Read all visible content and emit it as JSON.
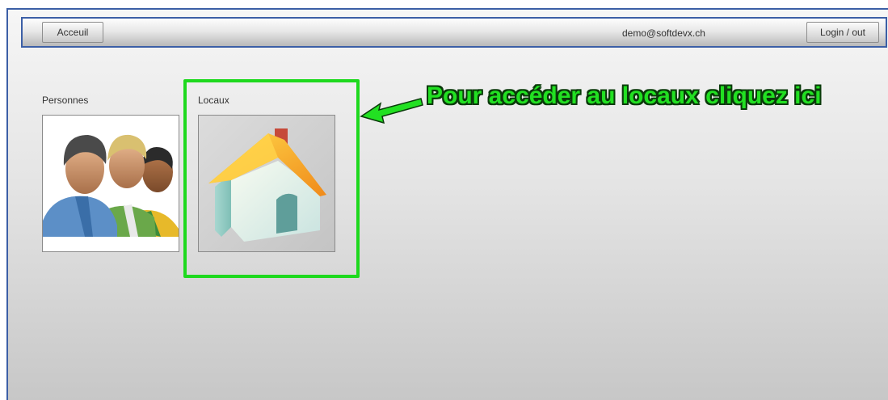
{
  "navbar": {
    "home_label": "Acceuil",
    "user_email": "demo@softdevx.ch",
    "login_label": "Login / out"
  },
  "tiles": [
    {
      "label": "Personnes",
      "icon": "people-icon"
    },
    {
      "label": "Locaux",
      "icon": "house-icon"
    }
  ],
  "annotation": {
    "text": "Pour accéder au locaux cliquez ici",
    "color": "#22e022"
  },
  "colors": {
    "frame_border": "#3c5fa6",
    "highlight": "#1ed91e"
  }
}
